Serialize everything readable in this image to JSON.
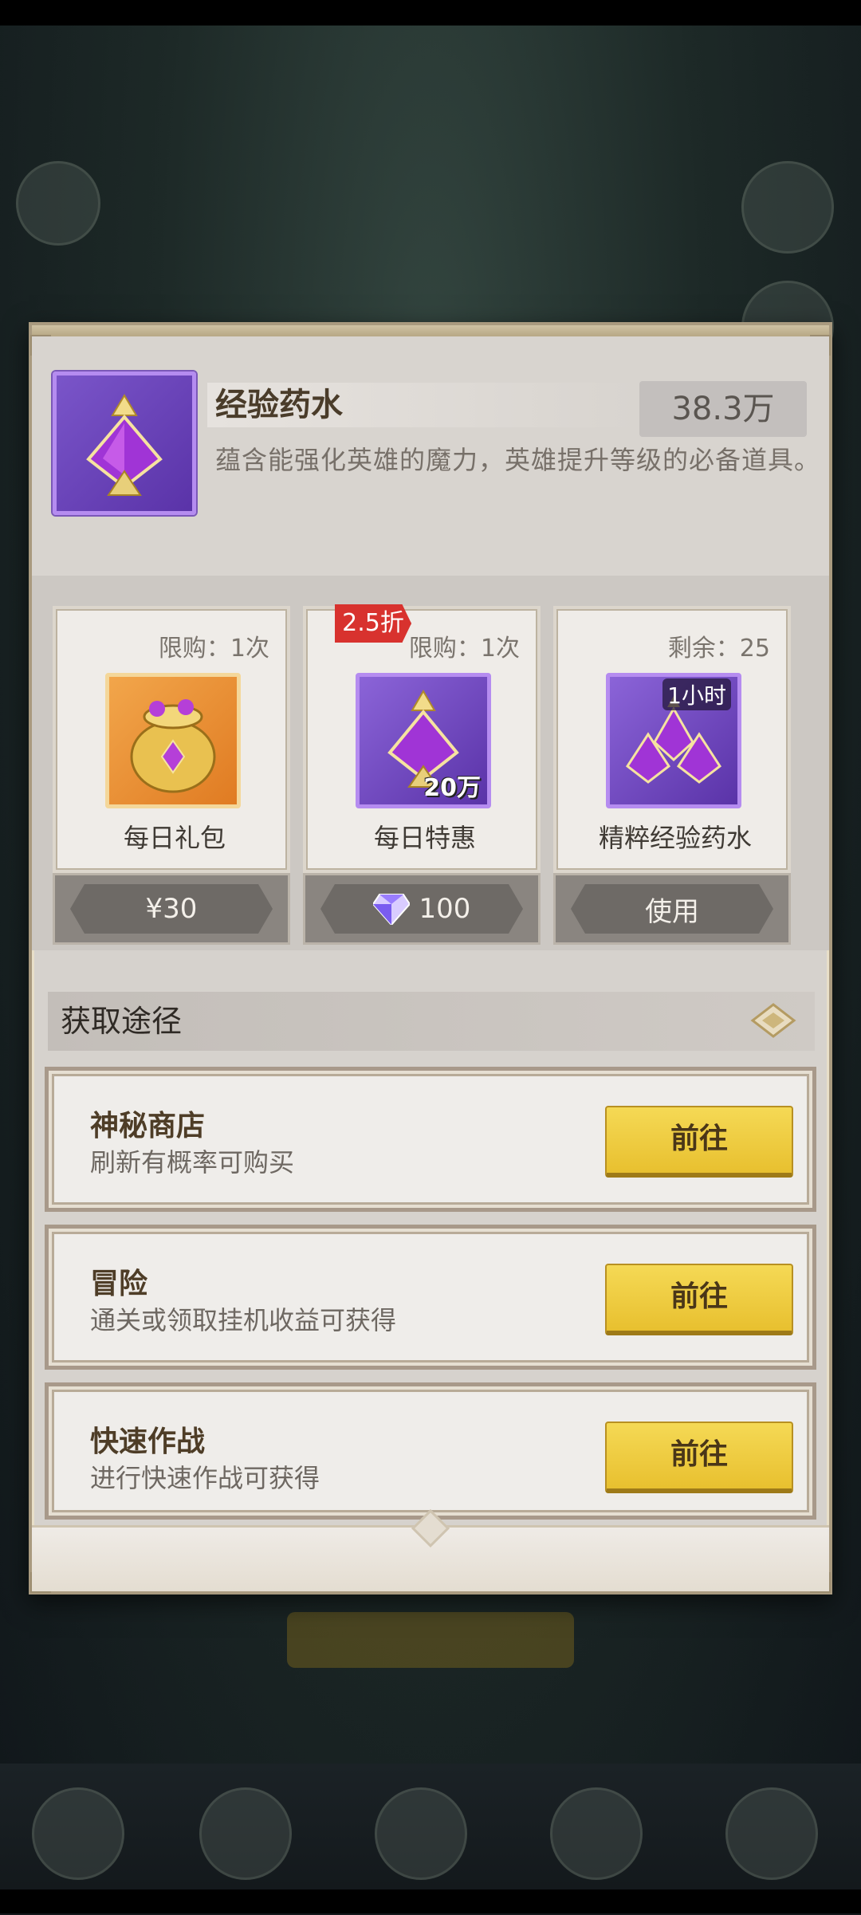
{
  "item": {
    "title": "经验药水",
    "count": "38.3万",
    "description": "蕴含能强化英雄的魔力，英雄提升等级的必备道具。",
    "icon": "purple-potion-icon"
  },
  "shop": {
    "cards": [
      {
        "limit": "限购：1次",
        "name": "每日礼包",
        "price": "¥30",
        "icon": "gold-bag-icon",
        "icon_label": ""
      },
      {
        "limit": "限购：1次",
        "name": "每日特惠",
        "price": "100",
        "icon": "purple-potion-icon",
        "icon_label": "20万",
        "discount": "2.5折",
        "currency_icon": "diamond-icon"
      },
      {
        "limit": "剩余：25",
        "name": "精粹经验药水",
        "price": "使用",
        "icon": "triple-potion-icon",
        "icon_label_top": "1小时"
      }
    ]
  },
  "acquire": {
    "title": "获取途径",
    "routes": [
      {
        "title": "神秘商店",
        "subtitle": "刷新有概率可购买",
        "button": "前往"
      },
      {
        "title": "冒险",
        "subtitle": "通关或领取挂机收益可获得",
        "button": "前往"
      },
      {
        "title": "快速作战",
        "subtitle": "进行快速作战可获得",
        "button": "前往"
      }
    ]
  },
  "colors": {
    "accent_gold": "#f0cf45",
    "discount_red": "#d8322e",
    "purple_frame": "#b58cf0"
  }
}
